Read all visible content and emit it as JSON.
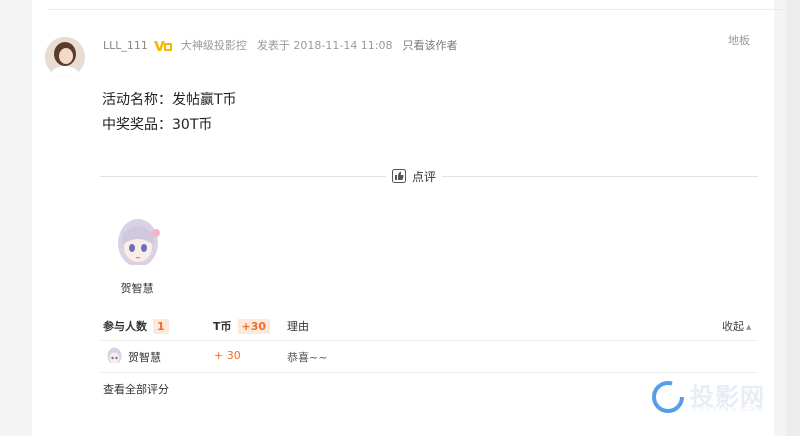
{
  "post": {
    "author_name": "LLL_111",
    "author_title": "大神级投影控",
    "post_time": "发表于 2018-11-14 11:08",
    "only_author_label": "只看该作者",
    "floor": "地板",
    "lines": [
      "活动名称：发帖赢T币",
      "中奖奖品：30T币"
    ]
  },
  "rating": {
    "button_label": "点评",
    "rater_name": "贺智慧",
    "table_header": {
      "participants_label": "参与人数",
      "participants_count": "1",
      "currency_label": "T币",
      "currency_total": "+30",
      "reason_label": "理由",
      "collapse_label": "收起"
    },
    "rows": [
      {
        "name": "贺智慧",
        "score": "+ 30",
        "reason": "恭喜~~"
      }
    ],
    "view_all_label": "查看全部评分"
  },
  "watermark": {
    "text": "投影网",
    "sub": "TOUYING.COM"
  },
  "colors": {
    "accent": "#f26c2a",
    "badge_bg": "#fde9dc",
    "vip_gold": "#f5b800"
  }
}
